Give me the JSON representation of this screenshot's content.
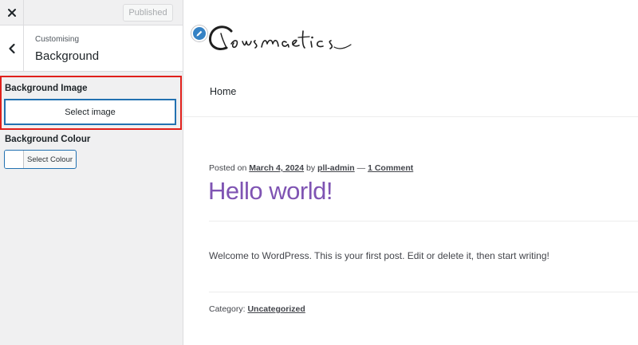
{
  "sidebar": {
    "close_icon": "close-icon",
    "published_label": "Published",
    "back_icon": "chevron-left-icon",
    "breadcrumb": "Customising",
    "section_title": "Background",
    "background_image": {
      "label": "Background Image",
      "button_label": "Select image"
    },
    "background_colour": {
      "label": "Background Colour",
      "button_label": "Select Colour",
      "swatch_color": "#ffffff"
    },
    "highlight_color": "#e0201b"
  },
  "preview": {
    "edit_icon": "pencil-icon",
    "nav": {
      "home": "Home"
    },
    "post": {
      "posted_on": "Posted on",
      "date": "March 4, 2024",
      "by": "by",
      "author": "pll-admin",
      "separator": "—",
      "comments": "1 Comment",
      "title": "Hello world!",
      "body": "Welcome to WordPress. This is your first post. Edit or delete it, then start writing!",
      "category_label": "Category:",
      "category": "Uncategorized"
    },
    "title_color": "#7f54b3"
  }
}
